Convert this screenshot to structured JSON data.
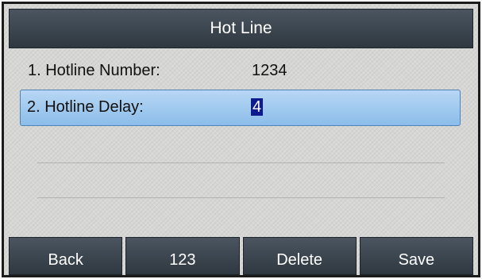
{
  "header": {
    "title": "Hot Line"
  },
  "fields": [
    {
      "label": "1. Hotline Number:",
      "value": "1234"
    },
    {
      "label": "2. Hotline Delay:",
      "value": "4"
    }
  ],
  "softkeys": [
    {
      "label": "Back"
    },
    {
      "label": "123"
    },
    {
      "label": "Delete"
    },
    {
      "label": "Save"
    }
  ],
  "colors": {
    "bar_bg": "#3c4650",
    "selected_row": "#a3cbef",
    "cursor_highlight": "#0d1b8c",
    "screen_bg": "#d6d6d4"
  }
}
